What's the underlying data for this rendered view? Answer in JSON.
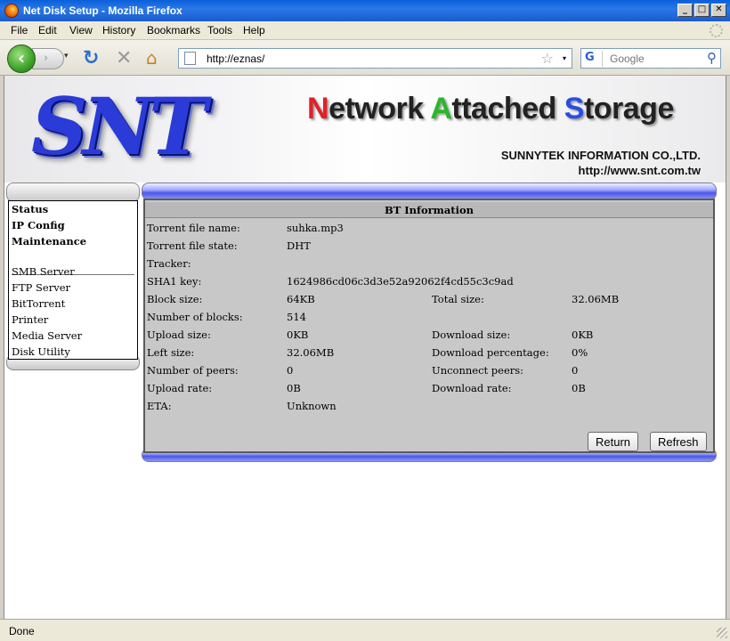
{
  "window": {
    "title": "Net Disk Setup - Mozilla Firefox",
    "min": "_",
    "max": "□",
    "close": "✕"
  },
  "menu": {
    "items": [
      "File",
      "Edit",
      "View",
      "History",
      "Bookmarks",
      "Tools",
      "Help"
    ]
  },
  "toolbar": {
    "back_glyph": "‹",
    "forward_glyph": "›",
    "dropdown_glyph": "▾",
    "reload_glyph": "↻",
    "stop_glyph": "✕",
    "home_glyph": "⌂",
    "url": "http://eznas/",
    "star_glyph": "☆",
    "search_engine": "G",
    "search_placeholder": "Google",
    "search_glyph": "⚲"
  },
  "banner": {
    "logo": "SNT",
    "title_parts": [
      "N",
      "etwork ",
      "A",
      "ttached ",
      "S",
      "torage"
    ],
    "company": "SUNNYTEK INFORMATION CO.,LTD.",
    "website": "http://www.snt.com.tw"
  },
  "sidebar": {
    "primary": [
      "Status",
      "IP Config",
      "Maintenance"
    ],
    "secondary": [
      "SMB Server",
      "FTP Server",
      "BitTorrent",
      "Printer",
      "Media Server",
      "Disk Utility"
    ]
  },
  "bt": {
    "title": "BT Information",
    "rows": [
      {
        "label": "Torrent file name:",
        "value": "suhka.mp3"
      },
      {
        "label": "Torrent file state:",
        "value": "DHT"
      },
      {
        "label": "Tracker:",
        "value": ""
      },
      {
        "label": "SHA1 key:",
        "value": "1624986cd06c3d3e52a92062f4cd55c3c9ad"
      },
      {
        "label": "Block size:",
        "value": "64KB",
        "label2": "Total size:",
        "value2": "32.06MB"
      },
      {
        "label": "Number of blocks:",
        "value": "514"
      },
      {
        "label": "Upload size:",
        "value": "0KB",
        "label2": "Download size:",
        "value2": "0KB"
      },
      {
        "label": "Left size:",
        "value": "32.06MB",
        "label2": "Download percentage:",
        "value2": "0%"
      },
      {
        "label": "Number of peers:",
        "value": "0",
        "label2": "Unconnect peers:",
        "value2": "0"
      },
      {
        "label": "Upload rate:",
        "value": "0B",
        "label2": "Download rate:",
        "value2": "0B"
      },
      {
        "label": "ETA:",
        "value": "Unknown"
      }
    ],
    "return_label": "Return",
    "refresh_label": "Refresh"
  },
  "status": {
    "text": "Done"
  }
}
